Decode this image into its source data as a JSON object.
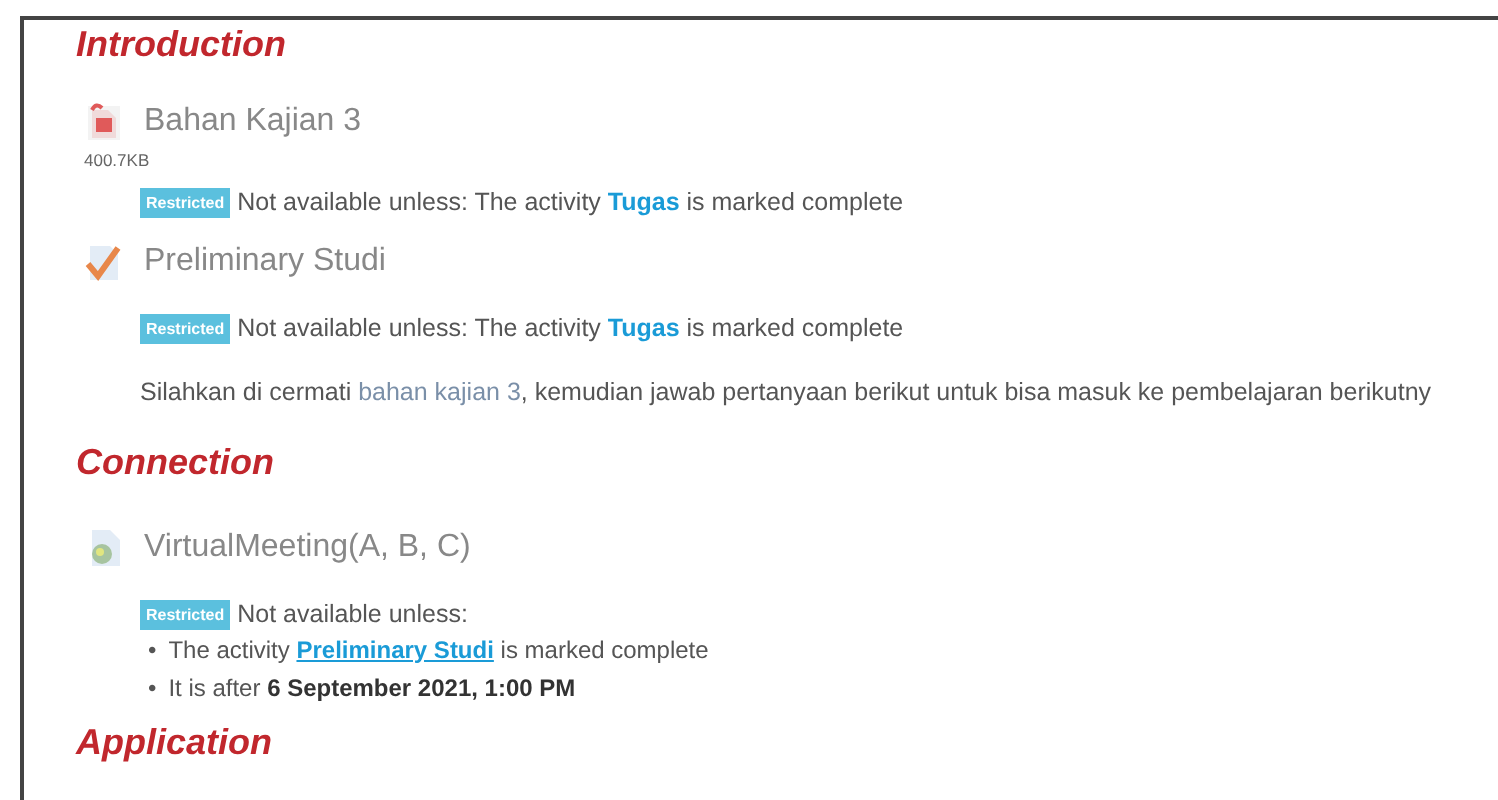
{
  "sections": [
    {
      "title": "Introduction",
      "items": [
        {
          "kind": "file",
          "name": "Bahan Kajian 3",
          "size": "400.7KB",
          "restriction": {
            "badge": "Restricted",
            "bulleted": false,
            "text": "Not available unless:",
            "conditions": [
              {
                "before": "The activity",
                "link": "Tugas",
                "after": "is marked complete"
              }
            ]
          }
        },
        {
          "kind": "assignment",
          "name": "Preliminary Studi",
          "restriction": {
            "badge": "Restricted",
            "bulleted": false,
            "text": "Not available unless:",
            "conditions": [
              {
                "before": "The activity",
                "link": "Tugas",
                "after": "is marked complete"
              }
            ]
          }
        },
        {
          "kind": "label",
          "before": "Silahkan di cermati",
          "link": "bahan kajian 3",
          "after": ", kemudian jawab pertanyaan berikut untuk bisa masuk ke pembelajaran berikutny"
        }
      ]
    },
    {
      "title": "Connection",
      "items": [
        {
          "kind": "url",
          "name": "VirtualMeeting(A, B, C)",
          "restriction": {
            "badge": "Restricted",
            "bulleted": true,
            "text": "Not available unless:",
            "conditions": [
              {
                "marker": "•",
                "before": "The activity",
                "link": "Preliminary Studi",
                "after": "is marked complete"
              },
              {
                "marker": "•",
                "before": "It is after",
                "bold": "6 September 2021, 1:00 PM"
              }
            ]
          }
        }
      ]
    },
    {
      "title": "Application"
    }
  ]
}
